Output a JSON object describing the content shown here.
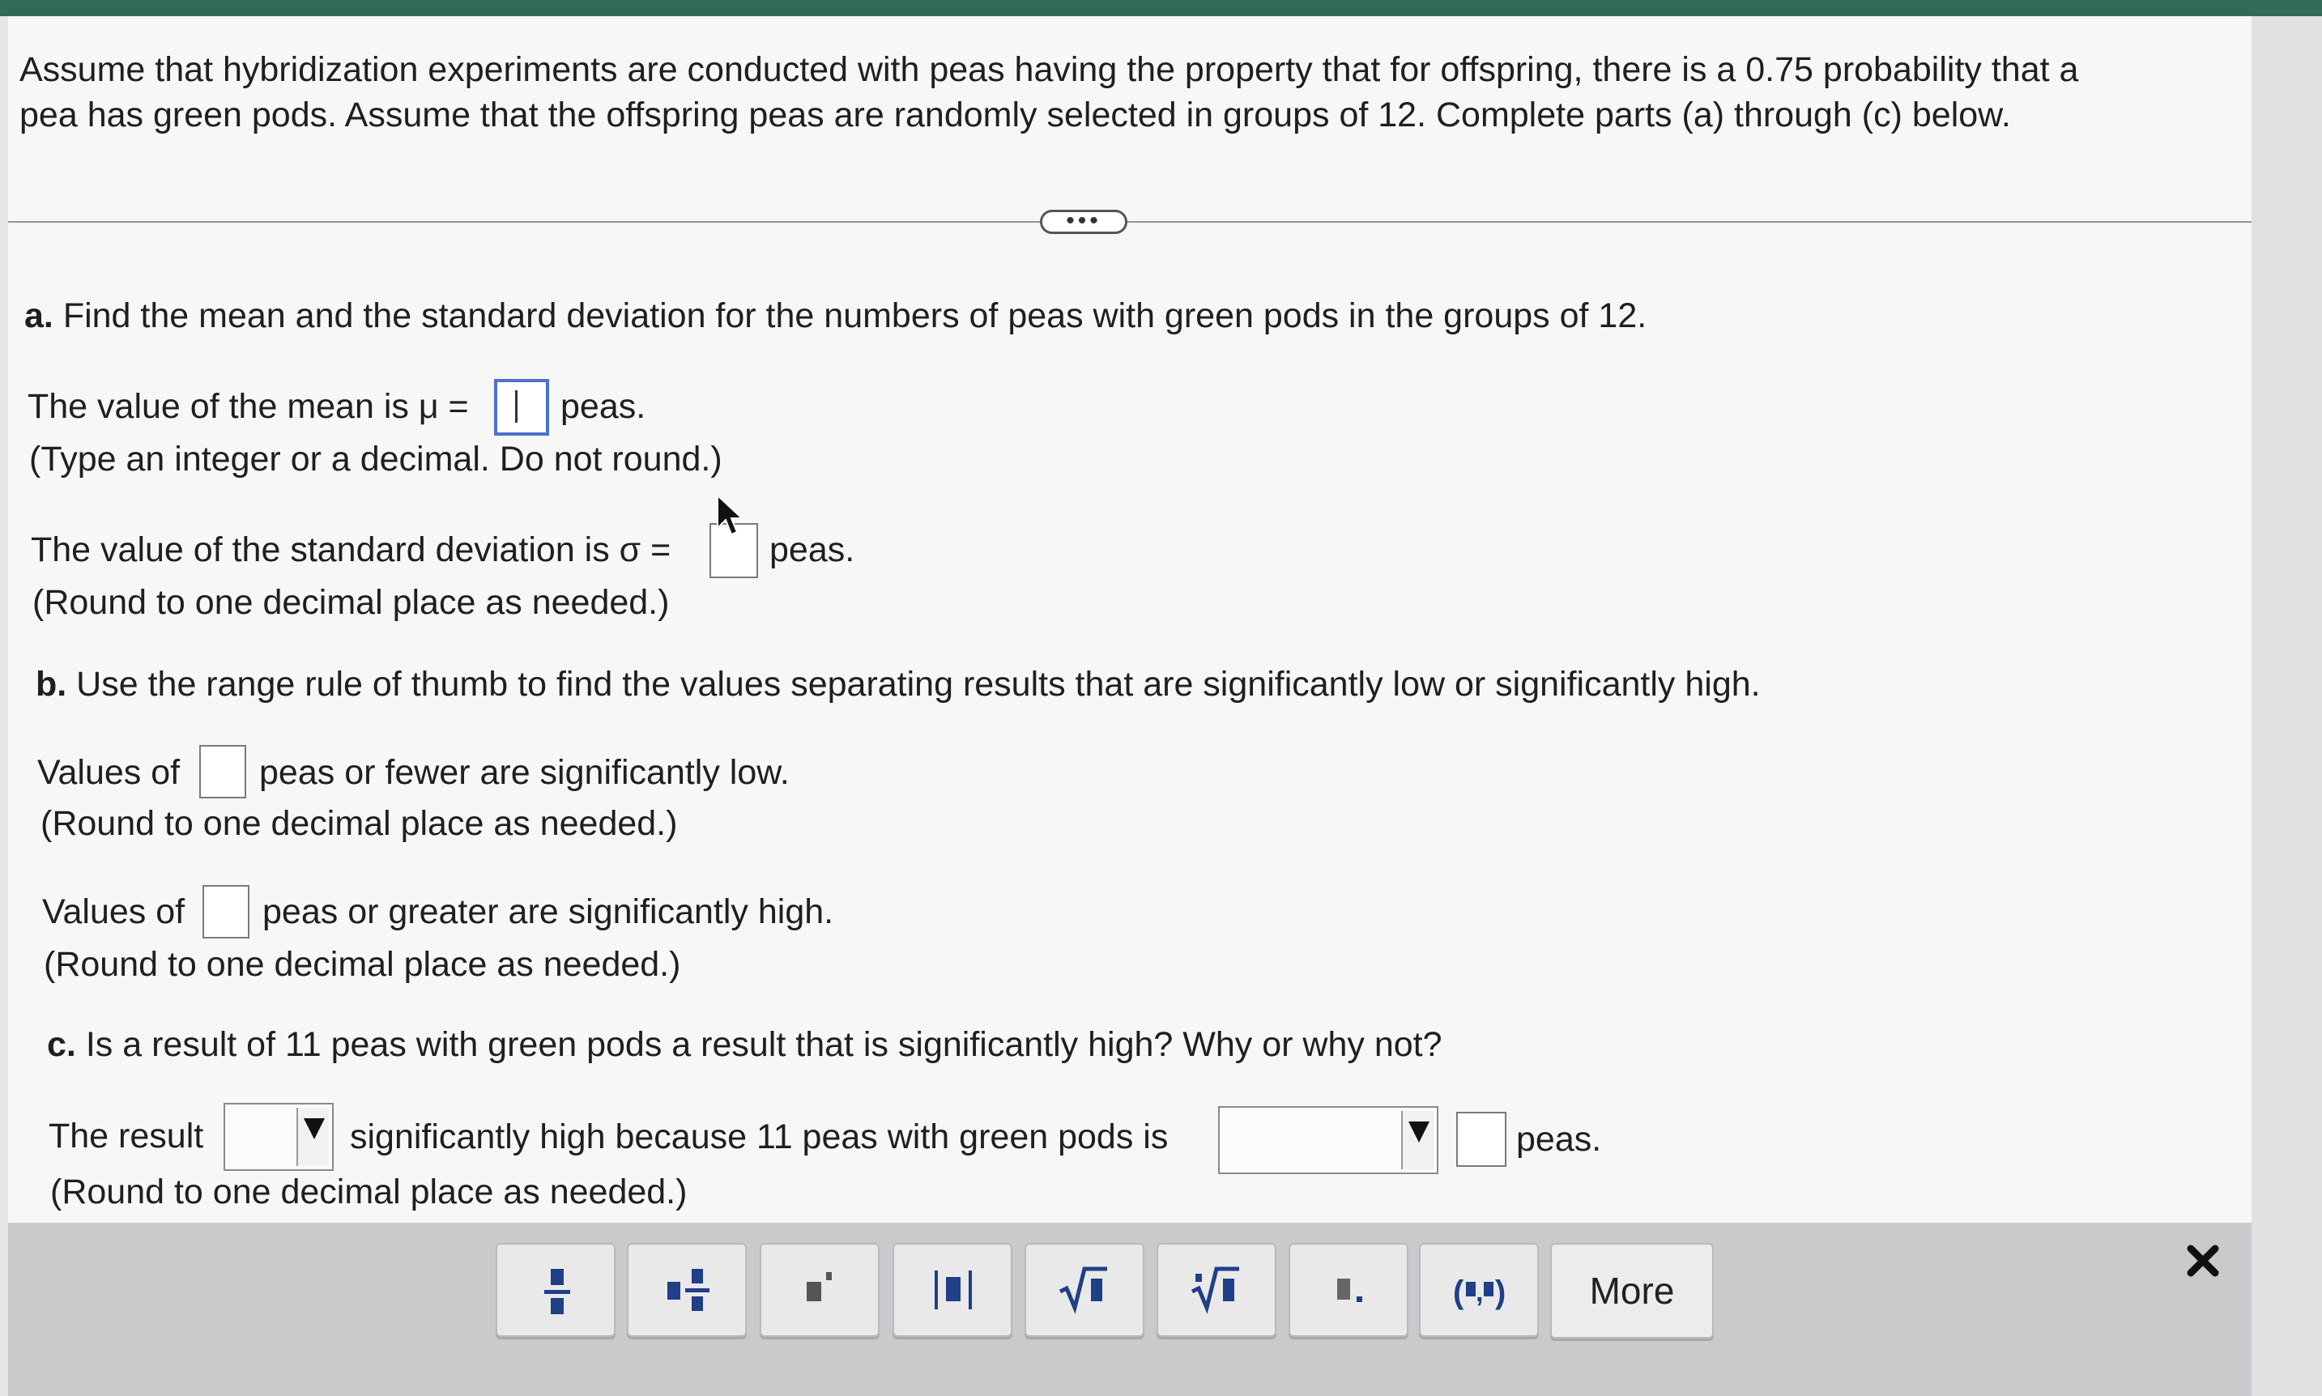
{
  "intro": {
    "line1": "Assume that hybridization experiments are conducted with peas having the property that for offspring, there is a 0.75 probability that a",
    "line2": "pea has green pods. Assume that the offspring peas are randomly selected in groups of 12. Complete parts (a) through (c) below."
  },
  "expand_label": "•••",
  "part_a": {
    "label": "a.",
    "question": "Find the mean and the standard deviation for the numbers of peas with green pods in the groups of 12.",
    "mean_prefix": "The value of the mean is μ =",
    "mean_suffix": "peas.",
    "mean_hint": "(Type an integer or a decimal. Do not round.)",
    "sd_prefix": "The value of the standard deviation is σ =",
    "sd_suffix": "peas.",
    "sd_hint": "(Round to one decimal place as needed.)"
  },
  "part_b": {
    "label": "b.",
    "question": "Use the range rule of thumb to find the values separating results that are significantly low or significantly high.",
    "low_prefix": "Values of",
    "low_suffix": "peas or fewer are significantly low.",
    "low_hint": "(Round to one decimal place as needed.)",
    "high_prefix": "Values of",
    "high_suffix": "peas or greater are significantly high.",
    "high_hint": "(Round to one decimal place as needed.)"
  },
  "part_c": {
    "label": "c.",
    "question": "Is a result of 11 peas with green pods a result that is significantly high? Why or why not?",
    "result_prefix": "The result",
    "result_middle": "significantly high because 11 peas with green pods is",
    "result_suffix": "peas.",
    "result_hint": "(Round to one decimal place as needed.)"
  },
  "toolbar": {
    "buttons": [
      "fraction",
      "mixed-number",
      "exponent",
      "absolute-value",
      "square-root",
      "nth-root",
      "decimal",
      "ordered-pair"
    ],
    "more_label": "More",
    "close_icon": "close-icon"
  },
  "colors": {
    "top_bar": "#2f6b58",
    "active_input_border": "#4a73c9",
    "toolbar_bg": "#c8cacb"
  }
}
